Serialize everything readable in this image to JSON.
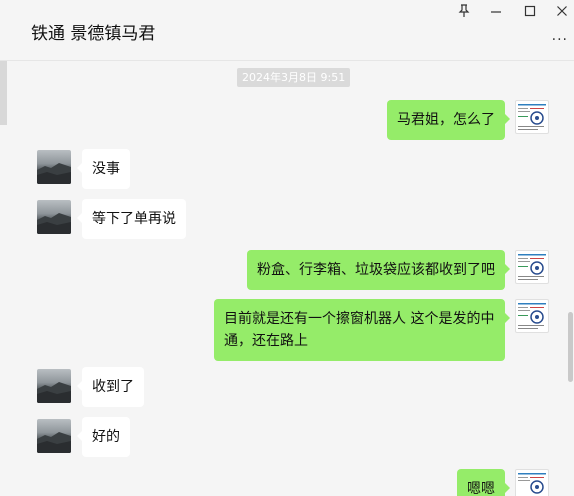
{
  "header": {
    "title": "铁通 景德镇马君",
    "pin_icon": "pin-icon",
    "minimize_icon": "minimize-icon",
    "maximize_icon": "maximize-icon",
    "close_icon": "close-icon",
    "more_label": "..."
  },
  "timestamp": "2024年3月8日 9:51",
  "colors": {
    "outgoing_bubble": "#95ec69",
    "incoming_bubble": "#ffffff",
    "background": "#f5f5f5"
  },
  "messages": [
    {
      "direction": "out",
      "text": "马君姐，怎么了"
    },
    {
      "direction": "in",
      "text": "没事"
    },
    {
      "direction": "in",
      "text": "等下了单再说"
    },
    {
      "direction": "out",
      "text": "粉盒、行李箱、垃圾袋应该都收到了吧"
    },
    {
      "direction": "out",
      "line1": "目前就是还有一个擦窗机器人 这个是发的中",
      "line2": "通，还在路上"
    },
    {
      "direction": "in",
      "text": "收到了"
    },
    {
      "direction": "in",
      "text": "好的"
    },
    {
      "direction": "out",
      "text": "嗯嗯"
    }
  ]
}
